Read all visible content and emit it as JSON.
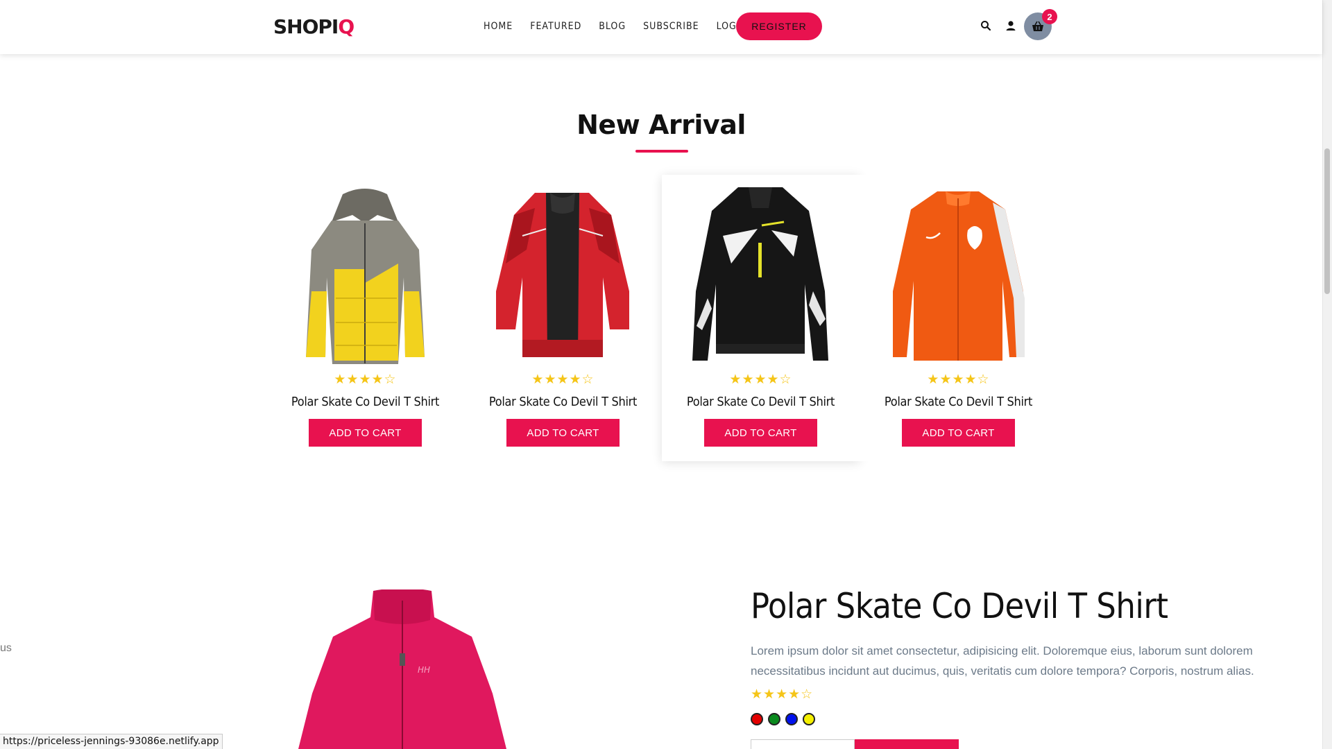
{
  "brand": {
    "name_main": "SHOPI",
    "name_accent": "Q",
    "accent_color": "#e8124f"
  },
  "nav": {
    "links": [
      "HOME",
      "FEATURED",
      "BLOG",
      "SUBSCRIBE",
      "LOGIN"
    ],
    "register_label": "REGISTER",
    "icons": [
      "search-icon",
      "user-icon",
      "basket-icon"
    ],
    "cart_count": "2"
  },
  "new_arrival": {
    "title": "New Arrival",
    "products": [
      {
        "name": "Polar Skate Co Devil T Shirt",
        "rating": 4,
        "max_rating": 5,
        "stars": "★★★★☆",
        "button": "ADD TO CART",
        "image": "yellow-grey-puffer-jacket"
      },
      {
        "name": "Polar Skate Co Devil T Shirt",
        "rating": 4,
        "max_rating": 5,
        "stars": "★★★★☆",
        "button": "ADD TO CART",
        "image": "red-black-ski-jacket"
      },
      {
        "name": "Polar Skate Co Devil T Shirt",
        "rating": 4,
        "max_rating": 5,
        "stars": "★★★★☆",
        "button": "ADD TO CART",
        "image": "black-white-motocross-jacket"
      },
      {
        "name": "Polar Skate Co Devil T Shirt",
        "rating": 4,
        "max_rating": 5,
        "stars": "★★★★☆",
        "button": "ADD TO CART",
        "image": "orange-track-jacket"
      }
    ]
  },
  "detail": {
    "edge_text": "us",
    "title": "Polar Skate Co Devil T Shirt",
    "description": "Lorem ipsum dolor sit amet consectetur, adipisicing elit. Doloremque eius, laborum sunt dolorem necessitatibus incidunt aut ducimus, quis, veritatis cum dolore tempora? Corporis, nostrum alias.",
    "rating": 4,
    "stars": "★★★★☆",
    "colors": [
      "#e30000",
      "#0a8a1e",
      "#0011ee",
      "#f5f000"
    ],
    "image": "pink-fleece-jacket"
  },
  "status_bar": {
    "url": "https://priceless-jennings-93086e.netlify.app"
  }
}
